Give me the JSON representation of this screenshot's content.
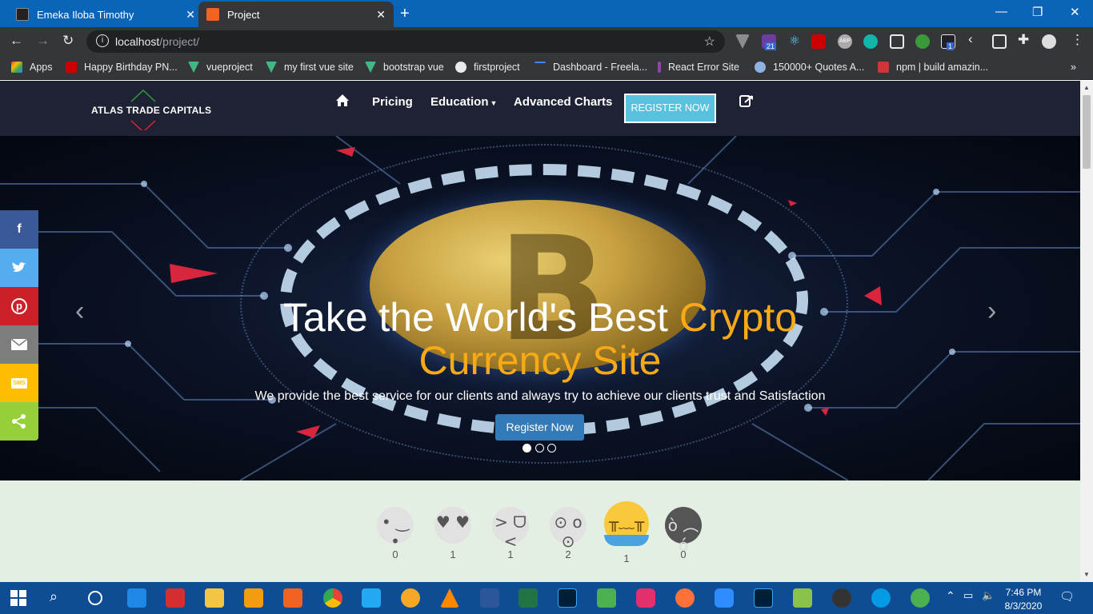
{
  "browser": {
    "tabs": [
      {
        "title": "Emeka Iloba Timothy",
        "active": false
      },
      {
        "title": "Project",
        "active": true
      }
    ],
    "url_host": "localhost",
    "url_path": "/project/",
    "extension_badges": {
      "badge_a": "21",
      "badge_b": "1",
      "abp": "ABP"
    },
    "bookmarks": [
      "Apps",
      "Happy Birthday PN...",
      "vueproject",
      "my first vue site",
      "bootstrap vue",
      "firstproject",
      "Dashboard - Freela...",
      "React Error Site",
      "150000+ Quotes A...",
      "npm | build amazin..."
    ],
    "more_bookmarks": "»"
  },
  "site": {
    "brand": "ATLAS TRADE CAPITALS",
    "nav": {
      "pricing": "Pricing",
      "education": "Education",
      "charts": "Advanced Charts",
      "register": "REGISTER NOW"
    },
    "hero": {
      "title_white": "Take the World's Best ",
      "title_accent_1": "Crypto",
      "title_accent_2": "Currency Site",
      "subtitle": "We provide the best service for our clients and always try to achieve our clients trust and Satisfaction",
      "cta": "Register Now",
      "active_slide": 1,
      "slide_count": 3
    },
    "share": [
      {
        "icon": "facebook-icon",
        "glyph": "f",
        "color": "#3b5998"
      },
      {
        "icon": "twitter-icon",
        "glyph": "🐦",
        "color": "#55acee"
      },
      {
        "icon": "pinterest-icon",
        "glyph": "P",
        "color": "#cb2027"
      },
      {
        "icon": "email-icon",
        "glyph": "✉",
        "color": "#7d7d7d"
      },
      {
        "icon": "sms-icon",
        "glyph": "SMS",
        "color": "#ffbd00"
      },
      {
        "icon": "share-icon",
        "glyph": "<",
        "color": "#95d03a"
      }
    ],
    "reactions": [
      {
        "icon": "smile-emoji-icon",
        "count": "0"
      },
      {
        "icon": "heart-eyes-emoji-icon",
        "count": "1"
      },
      {
        "icon": "laughing-emoji-icon",
        "count": "1"
      },
      {
        "icon": "surprised-emoji-icon",
        "count": "2"
      },
      {
        "icon": "crying-emoji-icon",
        "count": "1"
      },
      {
        "icon": "angry-emoji-icon",
        "count": "0"
      }
    ]
  },
  "taskbar": {
    "time": "7:46 PM",
    "date": "8/3/2020"
  },
  "colors": {
    "accent": "#f7a916",
    "nav_bg": "#1f2235",
    "register_btn": "#5bc0de",
    "cta_btn": "#337ab7",
    "reaction_bg": "#e2efe2"
  }
}
